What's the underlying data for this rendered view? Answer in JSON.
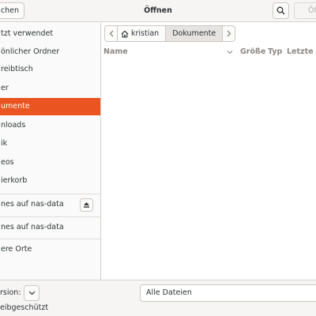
{
  "header": {
    "cancel_label": "chen",
    "title": "Öffnen",
    "open_label": "Öf"
  },
  "sidebar": {
    "items": [
      {
        "label": "tzt verwendet"
      },
      {
        "label": "önlicher Ordner"
      },
      {
        "label": "reibtisch"
      },
      {
        "label": "er"
      },
      {
        "label": "umente",
        "active": true
      },
      {
        "label": "nloads"
      },
      {
        "label": "ik"
      },
      {
        "label": "eos"
      },
      {
        "label": "ierkorb"
      }
    ],
    "network": [
      {
        "label": "nes auf nas-data"
      },
      {
        "label": "nes auf nas-data"
      }
    ],
    "other": {
      "label": "ere Orte"
    }
  },
  "pathbar": {
    "crumbs": [
      "kristian",
      "Dokumente"
    ]
  },
  "columns": {
    "name": "Name",
    "size": "Größe",
    "type": "Typ",
    "modified": "Letzte Ä"
  },
  "footer": {
    "encoding_label": "rsion:",
    "filter_value": "Alle Dateien",
    "readonly_label": "eibgeschützt"
  },
  "colors": {
    "accent": "#e95420",
    "header_bg": "#f6f5f4",
    "sidebar_bg": "#fafafa"
  },
  "icons": [
    "search-icon",
    "home-icon",
    "chevron-left-icon",
    "chevron-right-icon",
    "chevron-down-icon",
    "eject-icon"
  ]
}
